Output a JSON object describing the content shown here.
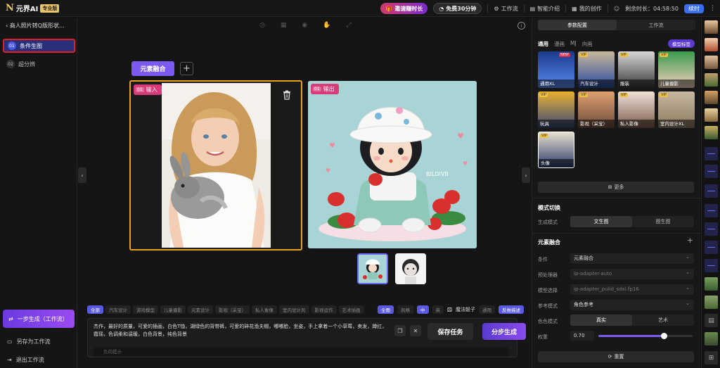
{
  "topbar": {
    "logo_mark": "N",
    "logo_text": "元界AI",
    "pro_badge": "专业版",
    "invite_label": "邀请赚时长",
    "free_label": "免费30分钟",
    "nav": [
      "工作流",
      "智能介绍",
      "我的创作"
    ],
    "duration_label": "剩余时长：04:58:50",
    "vip_label": "续时"
  },
  "left": {
    "project_title": "商人照片转Q版形状...",
    "steps": [
      {
        "num": "01",
        "label": "条件生图"
      },
      {
        "num": "02",
        "label": "超分辨"
      }
    ],
    "one_step_label": "一步生成（工作流）",
    "save_workflow_label": "另存为工作流",
    "exit_label": "退出工作流"
  },
  "canvas": {
    "node_tag": "元素融合",
    "input_label": {
      "num": "01",
      "text": "输入"
    },
    "output_label": {
      "num": "01",
      "text": "输出"
    },
    "watermark": "BILDIVB"
  },
  "prompt": {
    "chips": [
      "全部",
      "汽车设计",
      "游戏模型",
      "儿童摄影",
      "元素设计",
      "影视（采宝）",
      "私人象像",
      "室内设计风",
      "影视运作",
      "艺术插画"
    ],
    "right_chips": [
      "全图",
      "风格",
      "中",
      "英"
    ],
    "magic_label": "魔法骰子",
    "lang_label": "通用",
    "expand_label": "反推描述",
    "text": "杰作，最好的质量，可爱的插画，白色T恤，湖绿色的背带裤，可爱的碎花渔夫帽，嘟嘟脸，坐姿，手上拿着一个小草莓，卖发，蹲扛，霞瑶，色调柔和温暖，白色背景，纯色背景",
    "sub_placeholder": "负向提示",
    "save_btn": "保存任务",
    "generate_btn": "分步生成"
  },
  "right": {
    "tabs": [
      "参数配置",
      "工作流"
    ],
    "subtabs": [
      "通用",
      "漫画",
      "MJ",
      "向画"
    ],
    "model_tag": "模型标签",
    "styles": [
      {
        "label": "通用XL",
        "vip": "",
        "new": "NEW"
      },
      {
        "label": "汽车设计",
        "vip": "VIP",
        "new": ""
      },
      {
        "label": "服装",
        "vip": "VIP",
        "new": ""
      },
      {
        "label": "儿童摄影",
        "vip": "VIP",
        "new": ""
      },
      {
        "label": "玩具",
        "vip": "VIP",
        "new": ""
      },
      {
        "label": "影视（采宝）",
        "vip": "VIP",
        "new": ""
      },
      {
        "label": "私人影像",
        "vip": "VIP",
        "new": ""
      },
      {
        "label": "室内设计XL",
        "vip": "VIP",
        "new": ""
      },
      {
        "label": "头像",
        "vip": "VIP",
        "new": ""
      }
    ],
    "more_label": "更多",
    "mode_title": "模式切换",
    "mode_label": "生成模式",
    "mode_options": [
      "文生图",
      "图生图"
    ],
    "fusion_title": "元素融合",
    "condition_label": "条件",
    "condition_value": "元素融合",
    "preprocess_label": "预处理器",
    "preprocess_value": "ip-adapter-auto",
    "model_label": "模型选择",
    "model_value": "ip-adapter_pulid_sdxl.fp16",
    "ref_label": "参考模式",
    "ref_value": "角色参考",
    "color_label": "色色模式",
    "color_options": [
      "真实",
      "艺术"
    ],
    "weight_label": "权重",
    "weight_value": "0.70",
    "weight_fraction": 0.7,
    "reset_label": "重置"
  }
}
